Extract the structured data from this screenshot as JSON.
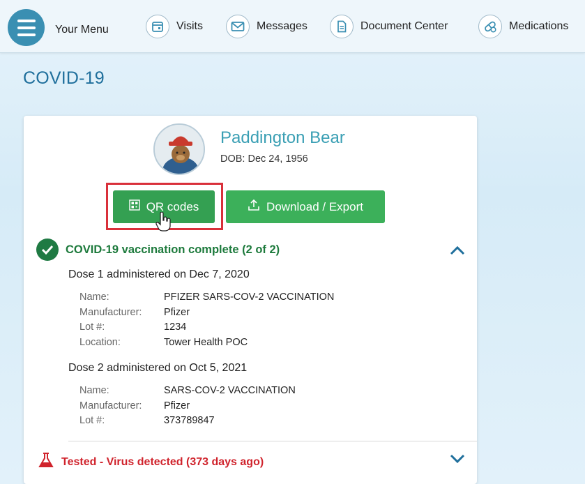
{
  "nav": {
    "menu_label": "Your Menu",
    "items": [
      {
        "label": "Visits",
        "icon": "calendar-icon"
      },
      {
        "label": "Messages",
        "icon": "envelope-icon"
      },
      {
        "label": "Document Center",
        "icon": "document-icon"
      },
      {
        "label": "Medications",
        "icon": "pills-icon"
      }
    ]
  },
  "page": {
    "title": "COVID-19"
  },
  "patient": {
    "name": "Paddington Bear",
    "dob": "DOB: Dec 24, 1956"
  },
  "actions": {
    "qr_label": "QR codes",
    "download_label": "Download / Export"
  },
  "vaccination": {
    "status": "COVID-19 vaccination complete (2 of 2)",
    "doses": [
      {
        "title": "Dose 1 administered on Dec 7, 2020",
        "fields": [
          {
            "key": "Name:",
            "value": "PFIZER SARS-COV-2 VACCINATION"
          },
          {
            "key": "Manufacturer:",
            "value": "Pfizer"
          },
          {
            "key": "Lot #:",
            "value": "1234"
          },
          {
            "key": "Location:",
            "value": "Tower Health POC"
          }
        ]
      },
      {
        "title": "Dose 2 administered on Oct 5, 2021",
        "fields": [
          {
            "key": "Name:",
            "value": "SARS-COV-2 VACCINATION"
          },
          {
            "key": "Manufacturer:",
            "value": "Pfizer"
          },
          {
            "key": "Lot #:",
            "value": "373789847"
          }
        ]
      }
    ]
  },
  "test": {
    "status": "Tested - Virus detected (373 days ago)"
  },
  "colors": {
    "accent": "#3a8fb2",
    "button_green": "#3cb05a",
    "success": "#1f7a43",
    "danger": "#d0232c",
    "highlight": "#d9303a"
  }
}
